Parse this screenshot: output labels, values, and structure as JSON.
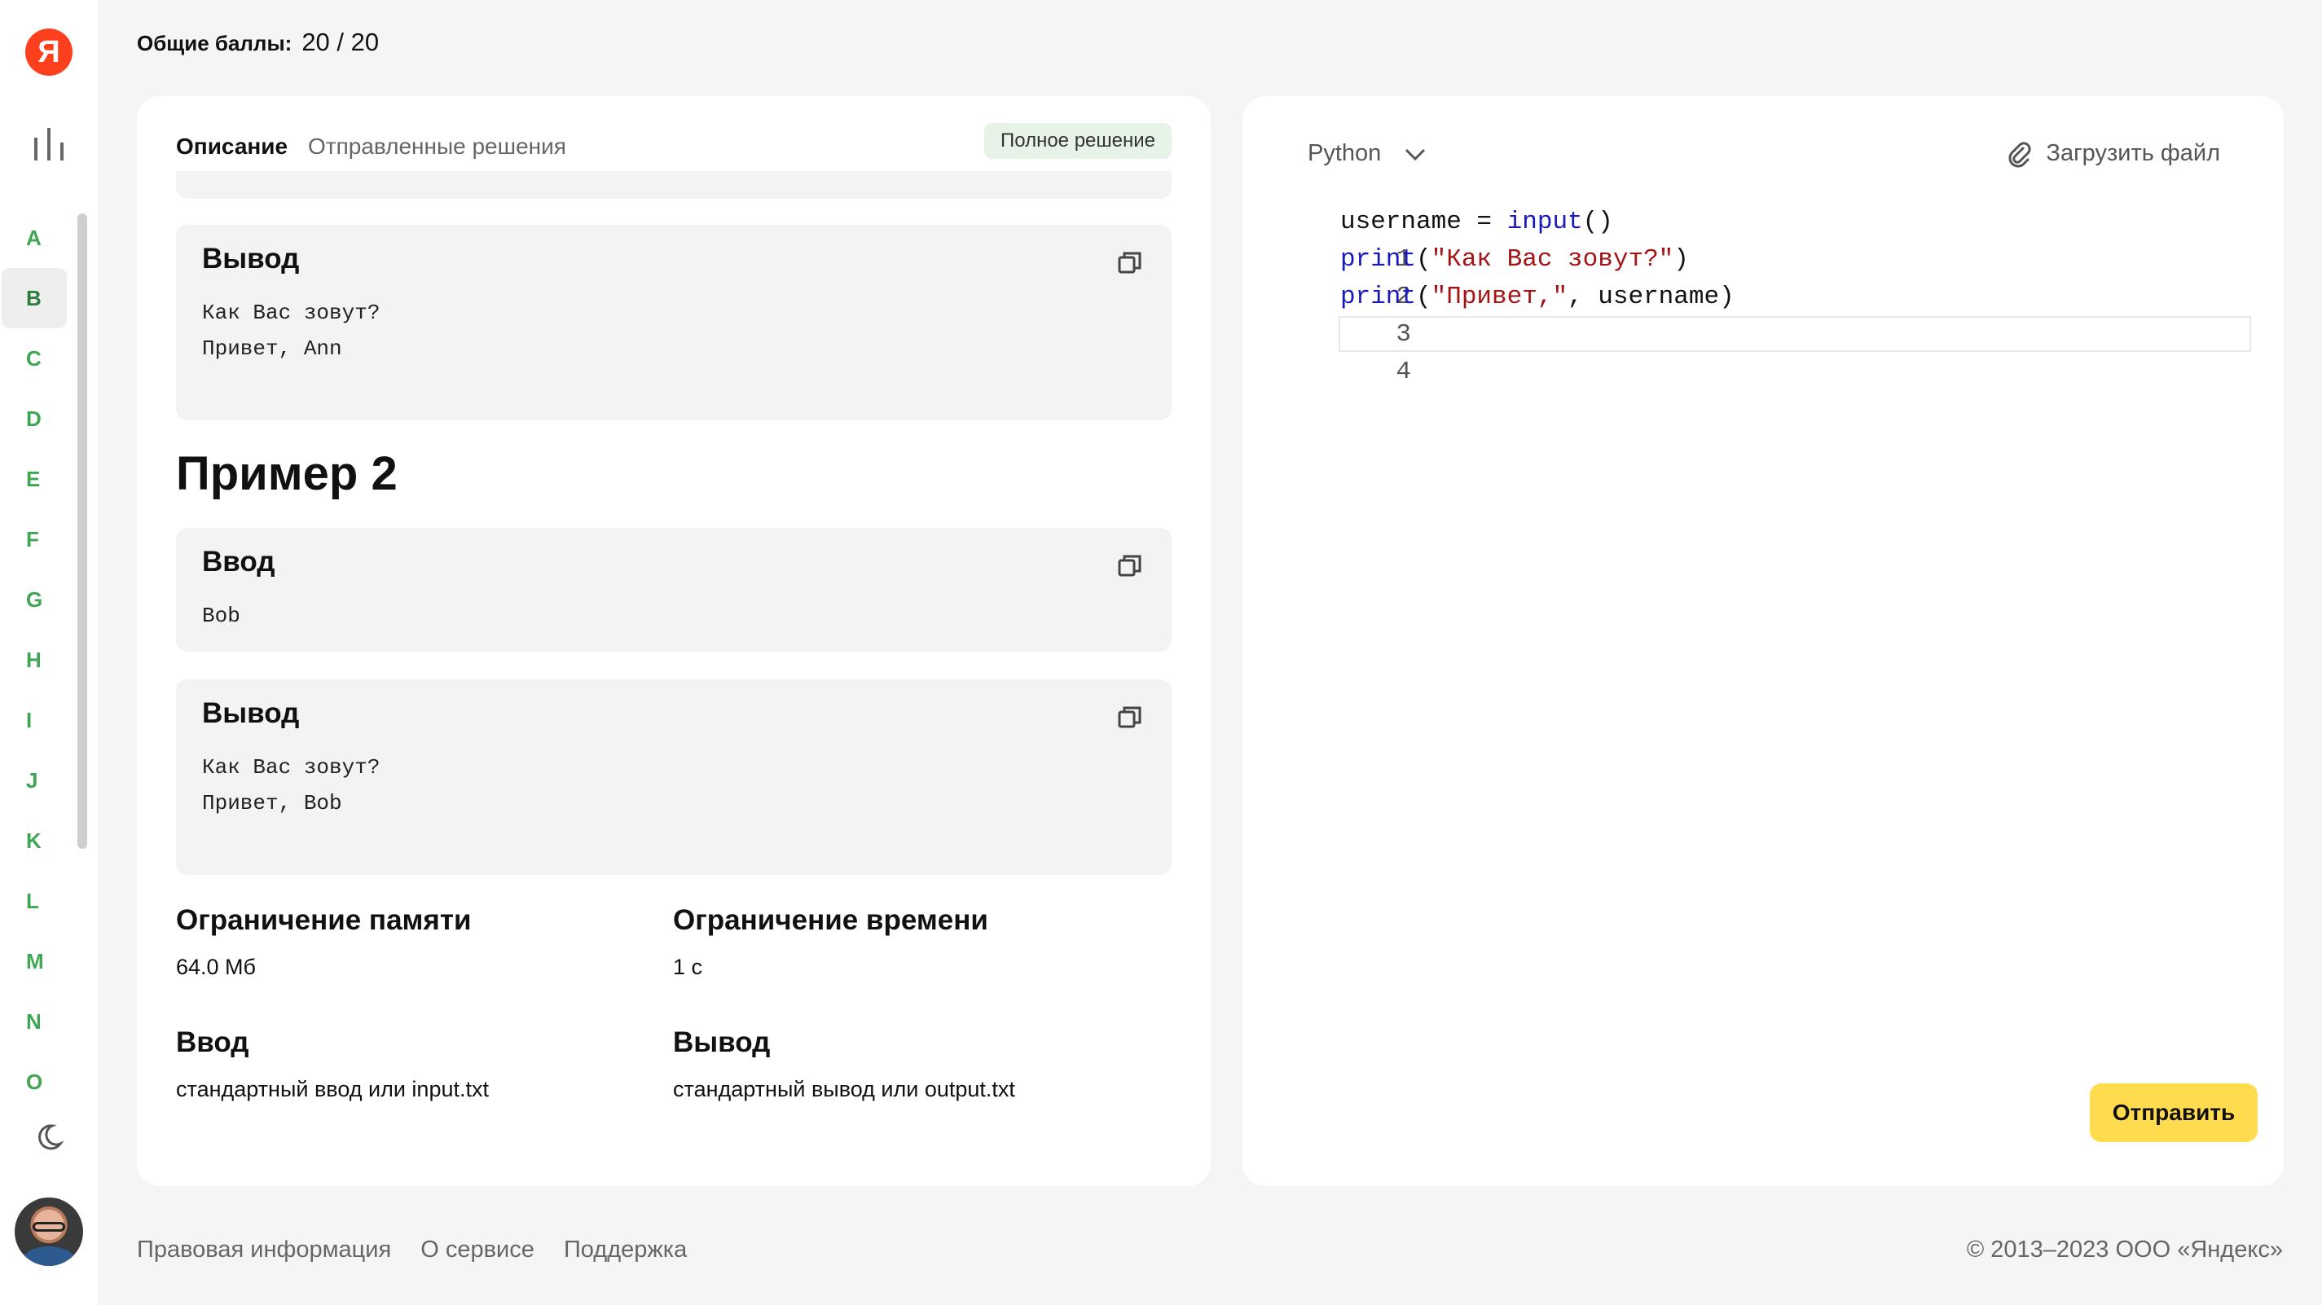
{
  "header": {
    "score_label": "Общие баллы:",
    "score_value": "20 / 20"
  },
  "sidebar": {
    "logo": "Я",
    "letters": [
      "A",
      "B",
      "C",
      "D",
      "E",
      "F",
      "G",
      "H",
      "I",
      "J",
      "K",
      "L",
      "M",
      "N",
      "O"
    ],
    "active_letter": "B"
  },
  "description": {
    "tabs": {
      "active": "Описание",
      "other": "Отправленные решения"
    },
    "badge": "Полное решение",
    "sample1_output": {
      "title": "Вывод",
      "lines": [
        "Как Вас зовут?",
        "Привет, Ann"
      ]
    },
    "example2_heading": "Пример 2",
    "sample2_input": {
      "title": "Ввод",
      "lines": [
        "Bob"
      ]
    },
    "sample2_output": {
      "title": "Вывод",
      "lines": [
        "Как Вас зовут?",
        "Привет, Bob"
      ]
    },
    "limits": {
      "memory_title": "Ограничение памяти",
      "memory_value": "64.0 Мб",
      "time_title": "Ограничение времени",
      "time_value": "1 с",
      "input_title": "Ввод",
      "input_value": "стандартный ввод или input.txt",
      "output_title": "Вывод",
      "output_value": "стандартный вывод или output.txt"
    }
  },
  "editor": {
    "language": "Python",
    "upload_label": "Загрузить файл",
    "line_numbers": [
      "1",
      "2",
      "3",
      "4"
    ],
    "code": {
      "l1_var": "username = ",
      "l1_fn": "input",
      "l1_rest": "()",
      "l2_fn": "print",
      "l2_open": "(",
      "l2_str": "\"Как Вас зовут?\"",
      "l2_close": ")",
      "l3_fn": "print",
      "l3_open": "(",
      "l3_str": "\"Привет,\"",
      "l3_rest": ", username)"
    },
    "submit_label": "Отправить"
  },
  "footer": {
    "links": [
      "Правовая информация",
      "О сервисе",
      "Поддержка"
    ],
    "copyright": "© 2013–2023 ООО «Яндекс»"
  },
  "colors": {
    "accent_yellow": "#ffdb4d",
    "letter_green": "#3fa654",
    "logo_red": "#fc3f1d"
  }
}
